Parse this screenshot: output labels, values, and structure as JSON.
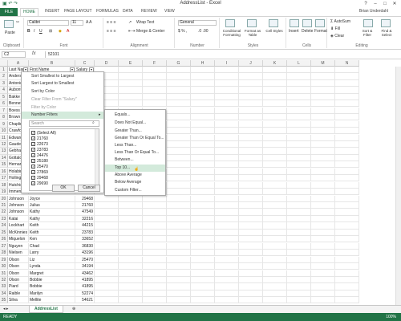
{
  "window": {
    "title": "AddressList - Excel",
    "user": "Brian Underdahl"
  },
  "tabs": [
    "FILE",
    "HOME",
    "INSERT",
    "PAGE LAYOUT",
    "FORMULAS",
    "DATA",
    "REVIEW",
    "VIEW"
  ],
  "ribbon": {
    "font_name": "Calibri",
    "font_size": "11",
    "number_format": "General",
    "paste": "Paste",
    "wrap_text": "Wrap Text",
    "merge_center": "Merge & Center",
    "conditional": "Conditional Formatting",
    "format_table": "Format as Table",
    "cell_styles": "Cell Styles",
    "insert": "Insert",
    "delete": "Delete",
    "format": "Format",
    "autosum": "AutoSum",
    "fill": "Fill",
    "clear": "Clear",
    "sort_filter": "Sort & Filter",
    "find_select": "Find & Select",
    "groups": [
      "Clipboard",
      "Font",
      "Alignment",
      "Number",
      "Styles",
      "Cells",
      "Editing"
    ]
  },
  "formula_bar": {
    "name_box": "C2",
    "fx": "fx",
    "value": "52101"
  },
  "columns": [
    "A",
    "B",
    "C",
    "D",
    "E",
    "F",
    "G",
    "H",
    "I",
    "J",
    "K",
    "L",
    "M",
    "N"
  ],
  "rows": [
    {
      "n": "1",
      "a": "Last Name",
      "b": "First Name",
      "c": "Salary"
    },
    {
      "n": "2",
      "a": "Anderson",
      "b": "",
      "c": ""
    },
    {
      "n": "3",
      "a": "Antonio",
      "b": "",
      "c": ""
    },
    {
      "n": "4",
      "a": "Aubont",
      "b": "",
      "c": ""
    },
    {
      "n": "5",
      "a": "Bakke",
      "b": "",
      "c": ""
    },
    {
      "n": "6",
      "a": "Bennett",
      "b": "",
      "c": ""
    },
    {
      "n": "7",
      "a": "Boess",
      "b": "",
      "c": ""
    },
    {
      "n": "8",
      "a": "Brown",
      "b": "",
      "c": ""
    },
    {
      "n": "9",
      "a": "Chaplin",
      "b": "",
      "c": ""
    },
    {
      "n": "10",
      "a": "Crawford",
      "b": "",
      "c": ""
    },
    {
      "n": "11",
      "a": "Edwards",
      "b": "",
      "c": ""
    },
    {
      "n": "12",
      "a": "Gaudet",
      "b": "",
      "c": ""
    },
    {
      "n": "13",
      "a": "Gebhardt",
      "b": "",
      "c": ""
    },
    {
      "n": "14",
      "a": "Gottalot",
      "b": "",
      "c": ""
    },
    {
      "n": "15",
      "a": "Hernandez",
      "b": "",
      "c": ""
    },
    {
      "n": "16",
      "a": "Holabird",
      "b": "",
      "c": ""
    },
    {
      "n": "17",
      "a": "Hollingsworth",
      "b": "",
      "c": ""
    },
    {
      "n": "18",
      "a": "Hutchison",
      "b": "",
      "c": ""
    },
    {
      "n": "19",
      "a": "Immerman",
      "b": "",
      "c": ""
    },
    {
      "n": "20",
      "a": "Johnson",
      "b": "Joyce",
      "c": "29468"
    },
    {
      "n": "21",
      "a": "Johnson",
      "b": "Julius",
      "c": "21760"
    },
    {
      "n": "22",
      "a": "Johnson",
      "b": "Kathy",
      "c": "47549"
    },
    {
      "n": "23",
      "a": "Katai",
      "b": "Kathy",
      "c": "32216"
    },
    {
      "n": "24",
      "a": "Lockhart",
      "b": "Keith",
      "c": "44215"
    },
    {
      "n": "25",
      "a": "McKinnies",
      "b": "Keith",
      "c": "23783"
    },
    {
      "n": "26",
      "a": "Miquelon",
      "b": "Ken",
      "c": "33652"
    },
    {
      "n": "27",
      "a": "Nguyen",
      "b": "Chad",
      "c": "36830"
    },
    {
      "n": "28",
      "a": "Nielsen",
      "b": "Larry",
      "c": "43196"
    },
    {
      "n": "29",
      "a": "Olson",
      "b": "Liz",
      "c": "25470"
    },
    {
      "n": "30",
      "a": "Olson",
      "b": "Lynda",
      "c": "34194"
    },
    {
      "n": "31",
      "a": "Olson",
      "b": "Margret",
      "c": "43462"
    },
    {
      "n": "32",
      "a": "Olson",
      "b": "Bobbie",
      "c": "41895"
    },
    {
      "n": "33",
      "a": "Piard",
      "b": "Bobbie",
      "c": "41895"
    },
    {
      "n": "34",
      "a": "Raible",
      "b": "Marilyn",
      "c": "52274"
    },
    {
      "n": "35",
      "a": "Silva",
      "b": "Mellite",
      "c": "54621"
    }
  ],
  "filter_menu": {
    "items": [
      "Sort Smallest to Largest",
      "Sort Largest to Smallest",
      "Sort by Color",
      "Clear Filter From \"Salary\"",
      "Filter by Color",
      "Number Filters"
    ],
    "search_placeholder": "Search",
    "values": [
      "(Select All)",
      "21760",
      "22673",
      "23783",
      "24476",
      "25180",
      "25470",
      "27869",
      "29468",
      "29690"
    ],
    "ok": "OK",
    "cancel": "Cancel"
  },
  "number_filters": [
    "Equals...",
    "Does Not Equal...",
    "Greater Than...",
    "Greater Than Or Equal To...",
    "Less Than...",
    "Less Than Or Equal To...",
    "Between...",
    "Top 10...",
    "Above Average",
    "Below Average",
    "Custom Filter..."
  ],
  "sheet_tab": "AddressList",
  "status": {
    "ready": "READY",
    "zoom": "100%"
  }
}
